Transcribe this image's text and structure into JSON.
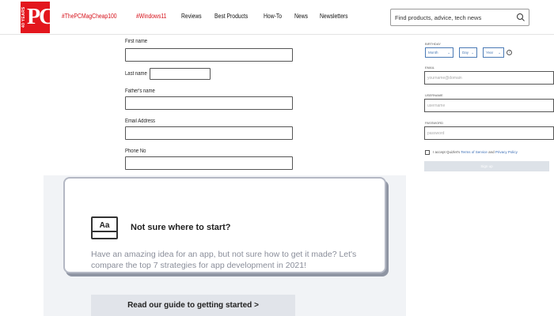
{
  "header": {
    "logo_text": "PC",
    "logo_years": "40 YEARS",
    "nav": [
      {
        "label": "#ThePCMagCheap100",
        "hot": true
      },
      {
        "label": "#Windows11",
        "hot": true
      },
      {
        "label": "Reviews",
        "hot": false
      },
      {
        "label": "Best Products",
        "hot": false
      },
      {
        "label": "How-To",
        "hot": false
      },
      {
        "label": "News",
        "hot": false
      },
      {
        "label": "Newsletters",
        "hot": false
      }
    ],
    "search_placeholder": "Find products, advice, tech news"
  },
  "form": {
    "first_name_label": "First name",
    "last_name_label": "Last name",
    "fathers_name_label": "Father's name",
    "email_label": "Email Address",
    "phone_label": "Phone No"
  },
  "side_form": {
    "birthday_label": "BIRTHDAY",
    "month": "Month",
    "day": "Day",
    "year": "Year",
    "email_label": "EMAIL",
    "email_placeholder": "yourname@domain",
    "username_label": "USERNAME",
    "username_placeholder": "username",
    "password_label": "PASSWORD",
    "password_placeholder": "password",
    "terms_prefix": "I accept Quizlet's",
    "terms_link": "Terms of Service",
    "terms_and": "and",
    "privacy_link": "Privacy Policy",
    "submit_label": "Sign up"
  },
  "promo": {
    "icon_text": "Aa",
    "title": "Not sure where to start?",
    "body": "Have an amazing idea for an app, but not sure how to get it made? Let's compare the top 7 strategies for app development in 2021!",
    "cta": "Read our guide to getting started >"
  },
  "colors": {
    "brand_red": "#e3161d",
    "nav_hot": "#d6121b",
    "link_blue": "#3a6db5"
  }
}
